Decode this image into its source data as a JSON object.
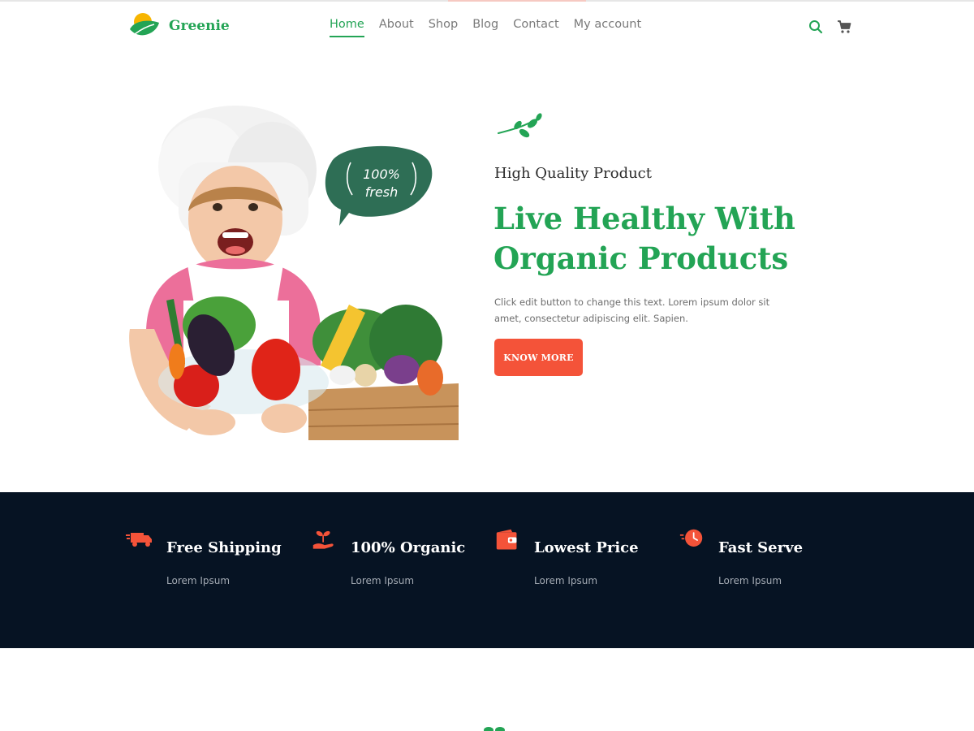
{
  "brand": {
    "name": "Greenie",
    "logo_icon": "leaf-sun-logo-icon"
  },
  "nav": {
    "items": [
      {
        "label": "Home",
        "active": true
      },
      {
        "label": "About",
        "active": false
      },
      {
        "label": "Shop",
        "active": false
      },
      {
        "label": "Blog",
        "active": false
      },
      {
        "label": "Contact",
        "active": false
      },
      {
        "label": "My account",
        "active": false
      }
    ]
  },
  "header_icons": [
    "search-icon",
    "cart-icon"
  ],
  "hero": {
    "badge_text": {
      "line1": "100%",
      "line2": "fresh"
    },
    "kicker": "High Quality Product",
    "title": "Live Healthy With Organic Products",
    "text": "Click edit button to change this text. Lorem ipsum dolor sit amet, consectetur adipiscing elit. Sapien.",
    "button_label": "KNOW MORE"
  },
  "features": [
    {
      "icon": "delivery-truck-icon",
      "title": "Free Shipping",
      "subtitle": "Lorem Ipsum"
    },
    {
      "icon": "plant-in-hand-icon",
      "title": "100% Organic",
      "subtitle": "Lorem Ipsum"
    },
    {
      "icon": "wallet-icon",
      "title": "Lowest Price",
      "subtitle": "Lorem Ipsum"
    },
    {
      "icon": "fast-clock-icon",
      "title": "Fast Serve",
      "subtitle": "Lorem Ipsum"
    }
  ],
  "colors": {
    "brand_green": "#23a455",
    "accent_orange": "#f45339",
    "dark_band": "#061323",
    "badge_green": "#2e6e55"
  }
}
